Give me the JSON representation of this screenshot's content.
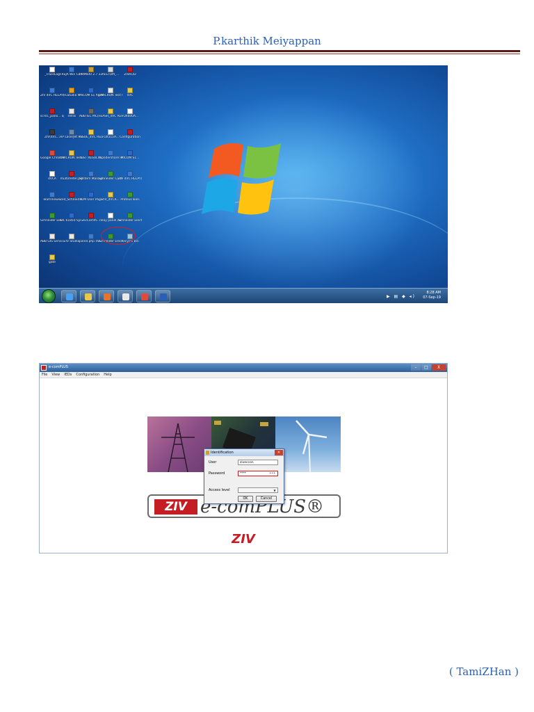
{
  "document": {
    "header": "P.karthik Meiyappan",
    "footer": "( TamiZHan )"
  },
  "desktop": {
    "icons": [
      {
        "label": "_TraceLog",
        "color": "#ffffff"
      },
      {
        "label": "FREJA Win Control...",
        "color": "#3a7bd5"
      },
      {
        "label": "PCM600 2.7 32 bit",
        "color": "#c8a23a"
      },
      {
        "label": "ALSTOM_...",
        "color": "#d0d8e0"
      },
      {
        "label": "ZIVeCID",
        "color": "#c41e24"
      },
      {
        "label": "ZIV 4VC RELAY(IEE...",
        "color": "#3a7bd5"
      },
      {
        "label": "FLStudio 9",
        "color": "#e8a020"
      },
      {
        "label": "MiCOM S1 Agile",
        "color": "#2a6ad0"
      },
      {
        "label": "OMICRON Test Univ...",
        "color": "#e8e8e8"
      },
      {
        "label": "4VC",
        "color": "#e8c84a"
      },
      {
        "label": "scr01_pano... operation",
        "color": "#c41e24"
      },
      {
        "label": "Trellis",
        "color": "#e8e8e8"
      },
      {
        "label": "ABB IEC MC(TE...",
        "color": "#6a6a6a"
      },
      {
        "label": "FLASH_4VC RELAY.AD",
        "color": "#e8c84a"
      },
      {
        "label": "FOX600A...",
        "color": "#ffffff"
      },
      {
        "label": "ZIV(4VC...",
        "color": "#3a3a3a"
      },
      {
        "label": "HP LaserJet Pro MFP...",
        "color": "#6a8ab0"
      },
      {
        "label": "ISSUE_4VC RELAY.DC",
        "color": "#e8c84a"
      },
      {
        "label": "FOX515A...",
        "color": "#ffffff"
      },
      {
        "label": "Configuration",
        "color": "#c41e24"
      },
      {
        "label": "Google Chrome",
        "color": "#e04a3a"
      },
      {
        "label": "OMICRON Test Univ...",
        "color": "#e8c84a"
      },
      {
        "label": "TEST RESULTS_4...",
        "color": "#c41e24"
      },
      {
        "label": "Wondershare PDF...",
        "color": "#3a7bd5"
      },
      {
        "label": "MICOM S1...",
        "color": "#2a6ad0"
      },
      {
        "label": "4VCA",
        "color": "#ffffff"
      },
      {
        "label": "multimeter.pdf",
        "color": "#c41e24"
      },
      {
        "label": "System Manager",
        "color": "#3a7bd5"
      },
      {
        "label": "Schneider Config",
        "color": "#3a9a3a"
      },
      {
        "label": "ZIV 4VC RELAY(IEE...",
        "color": "#3a7bd5"
      },
      {
        "label": "TeamViewer",
        "color": "#3a7bd5"
      },
      {
        "label": "Zed_Schneid Easy Pulp...",
        "color": "#c41e24"
      },
      {
        "label": "PCM User Page",
        "color": "#2a6ad0"
      },
      {
        "label": "ZIV_4VCR...",
        "color": "#e8c84a"
      },
      {
        "label": "ProteusTools",
        "color": "#3a9a3a"
      },
      {
        "label": "Schneider Electric Dev...",
        "color": "#3a9a3a"
      },
      {
        "label": "IEC 61850 Sys Page",
        "color": "#2a6ad0"
      },
      {
        "label": "ZivComPL...",
        "color": "#c41e24"
      },
      {
        "label": "relay panel.rar",
        "color": "#ffffff"
      },
      {
        "label": "Schneider Electric Min...",
        "color": "#3a9a3a"
      },
      {
        "label": "ABB GIS Service",
        "color": "#e8e8e8"
      },
      {
        "label": "ZIV Studio",
        "color": "#e8e8e8"
      },
      {
        "label": "panel.php 4VC IED",
        "color": "#3a7bd5"
      },
      {
        "label": "Schneider Electric...",
        "color": "#3a9a3a"
      },
      {
        "label": "Recycle Bin",
        "color": "#a0c0e0"
      },
      {
        "label": "gate",
        "color": "#e8c84a"
      }
    ],
    "taskbar": {
      "apps": [
        {
          "name": "internet-explorer",
          "color": "#4aa0f0"
        },
        {
          "name": "windows-explorer",
          "color": "#e8c84a"
        },
        {
          "name": "media-player",
          "color": "#e8742a"
        },
        {
          "name": "document",
          "color": "#e8e8e8"
        },
        {
          "name": "chrome",
          "color": "#e04a3a"
        },
        {
          "name": "word",
          "color": "#2a5fb8"
        }
      ],
      "time": "8:28 AM",
      "date": "07-Sep-19"
    }
  },
  "app": {
    "title": "e-comPLUS",
    "menu": [
      "File",
      "View",
      "IEDs",
      "Configuration",
      "Help"
    ],
    "window_controls": [
      "–",
      "□",
      "X"
    ],
    "logo_brand": "ZIV",
    "logo_product": "e-comPLUS®",
    "logo_bottom": "ZIV",
    "dialog": {
      "title": "Identification",
      "user_label": "User",
      "user_value": "ziveccon",
      "password_label": "Password",
      "password_value": "****",
      "access_label": "Access level",
      "ok": "OK",
      "cancel": "Cancel"
    }
  }
}
